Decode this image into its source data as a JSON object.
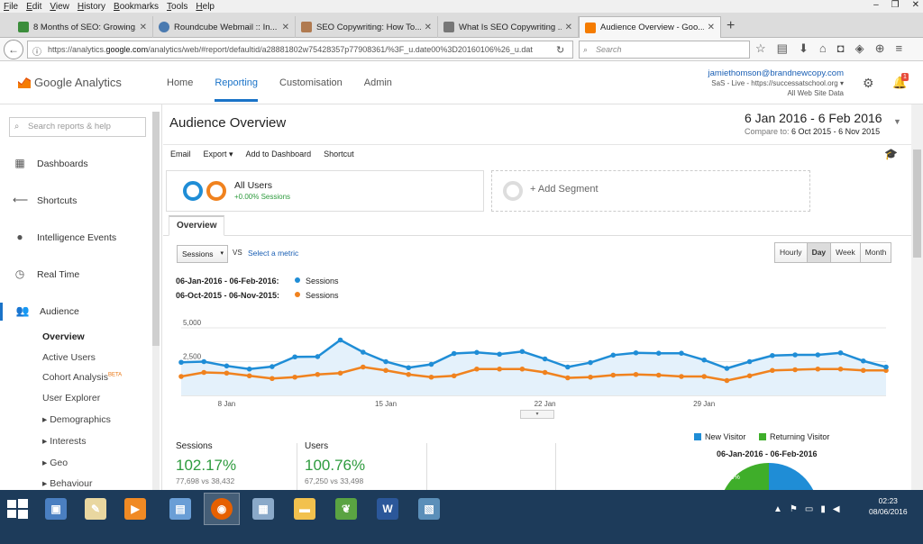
{
  "menubar": {
    "items": [
      {
        "u": "F",
        "rest": "ile"
      },
      {
        "u": "E",
        "rest": "dit"
      },
      {
        "u": "V",
        "rest": "iew"
      },
      {
        "u": "H",
        "rest": "istory"
      },
      {
        "u": "B",
        "rest": "ookmarks"
      },
      {
        "u": "T",
        "rest": "ools"
      },
      {
        "u": "H",
        "rest": "elp"
      }
    ]
  },
  "window_controls": {
    "minimize": "–",
    "restore": "❐",
    "close": "✕"
  },
  "tabs": [
    {
      "title": "8 Months of SEO: Growing...",
      "color": "#3b8d3b"
    },
    {
      "title": "Roundcube Webmail :: In...",
      "color": "#4a7ab0"
    },
    {
      "title": "SEO Copywriting: How To...",
      "color": "#b07a50"
    },
    {
      "title": "What Is SEO Copywriting ...",
      "color": "#777777"
    },
    {
      "title": "Audience Overview - Goo...",
      "color": "#f57c00"
    }
  ],
  "newtab": "+",
  "nav": {
    "url_prefix": "https://analytics.",
    "url_domain": "google.com",
    "url_rest": "/analytics/web/#report/defaultid/a28881802w75428357p77908361/%3F_u.date00%3D20160106%26_u.dat",
    "search_placeholder": "Search"
  },
  "ga": {
    "logo_text": "Google Analytics",
    "nav": [
      "Home",
      "Reporting",
      "Customisation",
      "Admin"
    ],
    "active_nav": "Reporting",
    "account_email": "jamiethomson@brandnewcopy.com",
    "property": "SaS - Live - https://successatschool.org",
    "view": "All Web Site Data",
    "notification_count": "1"
  },
  "sidebar": {
    "search_placeholder": "Search reports & help",
    "items": [
      {
        "label": "Dashboards",
        "icon": "▦",
        "name": "dashboards"
      },
      {
        "label": "Shortcuts",
        "icon": "⟵",
        "name": "shortcuts"
      },
      {
        "label": "Intelligence Events",
        "icon": "●",
        "name": "intelligence-events"
      },
      {
        "label": "Real Time",
        "icon": "◷",
        "name": "real-time"
      },
      {
        "label": "Audience",
        "icon": "👥",
        "name": "audience"
      }
    ],
    "subitems": [
      "Overview",
      "Active Users",
      "Cohort Analysis",
      "User Explorer",
      "▸ Demographics",
      "▸ Interests",
      "▸ Geo",
      "▸ Behaviour"
    ],
    "beta_label": "BETA"
  },
  "report": {
    "title": "Audience Overview",
    "date_range": "6 Jan 2016 - 6 Feb 2016",
    "compare_label": "Compare to:",
    "compare_range": "6 Oct 2015 - 6 Nov 2015",
    "actions": [
      "Email",
      "Export ▾",
      "Add to Dashboard",
      "Shortcut"
    ],
    "segment_name": "All Users",
    "segment_sub": "+0.00% Sessions",
    "add_segment": "+ Add Segment",
    "tab": "Overview",
    "metric_select": "Sessions",
    "vs": "VS",
    "select_metric": "Select a metric",
    "granularity": [
      "Hourly",
      "Day",
      "Week",
      "Month"
    ],
    "granularity_active": "Day",
    "legend": [
      {
        "range": "06-Jan-2016 - 06-Feb-2016:",
        "metric": "Sessions",
        "color": "#1f8dd6"
      },
      {
        "range": "06-Oct-2015 - 06-Nov-2015:",
        "metric": "Sessions",
        "color": "#f0821e"
      }
    ],
    "collapse_arrow": "▾",
    "metrics": [
      {
        "label": "Sessions",
        "value": "102.17%",
        "compare": "77,698 vs 38,432"
      },
      {
        "label": "Users",
        "value": "100.76%",
        "compare": "67,250 vs 33,498"
      }
    ],
    "pie": {
      "legend": [
        {
          "label": "New Visitor",
          "color": "#1f8dd6"
        },
        {
          "label": "Returning Visitor",
          "color": "#3fae2a"
        }
      ],
      "title": "06-Jan-2016 - 06-Feb-2016",
      "slice_label": "15.9%"
    }
  },
  "chart_data": {
    "type": "line",
    "y_ticks": [
      "5,000",
      "2,500"
    ],
    "ylim": [
      0,
      5000
    ],
    "x_tick_labels": [
      "8 Jan",
      "15 Jan",
      "22 Jan",
      "29 Jan"
    ],
    "x_tick_index": [
      2,
      9,
      16,
      23
    ],
    "series": [
      {
        "name": "Sessions",
        "color": "#1f8dd6",
        "values": [
          2450,
          2500,
          2180,
          1950,
          2130,
          2850,
          2870,
          4100,
          3200,
          2500,
          2050,
          2300,
          3100,
          3180,
          3050,
          3250,
          2700,
          2100,
          2430,
          2980,
          3150,
          3120,
          3120,
          2620,
          2000,
          2500,
          2950,
          3000,
          3000,
          3150,
          2550,
          2100
        ]
      },
      {
        "name": "Sessions",
        "color": "#f0821e",
        "values": [
          1400,
          1700,
          1650,
          1450,
          1250,
          1350,
          1550,
          1650,
          2100,
          1850,
          1550,
          1350,
          1450,
          1950,
          1950,
          1950,
          1700,
          1300,
          1350,
          1500,
          1550,
          1500,
          1400,
          1400,
          1100,
          1450,
          1850,
          1900,
          1950,
          1950,
          1850,
          1850
        ]
      }
    ]
  }
}
